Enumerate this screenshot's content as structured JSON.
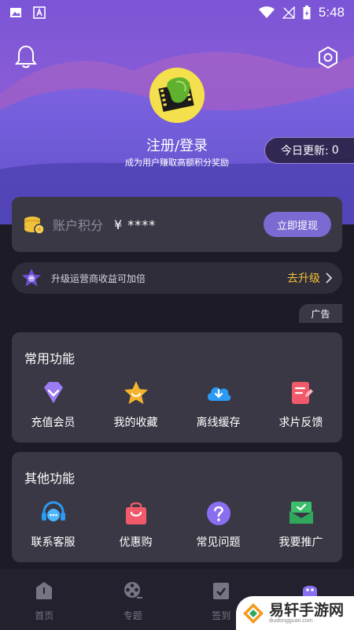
{
  "status_bar": {
    "time": "5:48"
  },
  "header": {
    "login_title": "注册/登录",
    "login_subtitle": "成为用户赚取高额积分奖励",
    "update_label": "今日更新:",
    "update_count": "0"
  },
  "points": {
    "label": "账户积分",
    "value": "¥ ****",
    "withdraw_label": "立即提现"
  },
  "upgrade": {
    "text": "升级运营商收益可加倍",
    "link_label": "去升级"
  },
  "ad_label": "广告",
  "common": {
    "title": "常用功能",
    "items": [
      {
        "label": "充值会员",
        "icon": "diamond-icon"
      },
      {
        "label": "我的收藏",
        "icon": "star-icon"
      },
      {
        "label": "离线缓存",
        "icon": "cloud-download-icon"
      },
      {
        "label": "求片反馈",
        "icon": "edit-note-icon"
      }
    ]
  },
  "other": {
    "title": "其他功能",
    "items": [
      {
        "label": "联系客服",
        "icon": "headset-icon"
      },
      {
        "label": "优惠购",
        "icon": "shopping-bag-icon"
      },
      {
        "label": "常见问题",
        "icon": "question-icon"
      },
      {
        "label": "我要推广",
        "icon": "promote-mail-icon"
      }
    ]
  },
  "bottom_nav": {
    "items": [
      {
        "label": "首页",
        "icon": "home-icon"
      },
      {
        "label": "专题",
        "icon": "film-reel-icon"
      },
      {
        "label": "签到",
        "icon": "checkin-icon"
      },
      {
        "label": "",
        "icon": "profile-icon"
      }
    ]
  },
  "watermark": {
    "text": "易轩手游网",
    "sub": "ibudongguan.com"
  },
  "colors": {
    "accent": "#7a6ad1",
    "gold": "#f1c13b",
    "background": "#1d1b26",
    "card": "#3a3845"
  }
}
